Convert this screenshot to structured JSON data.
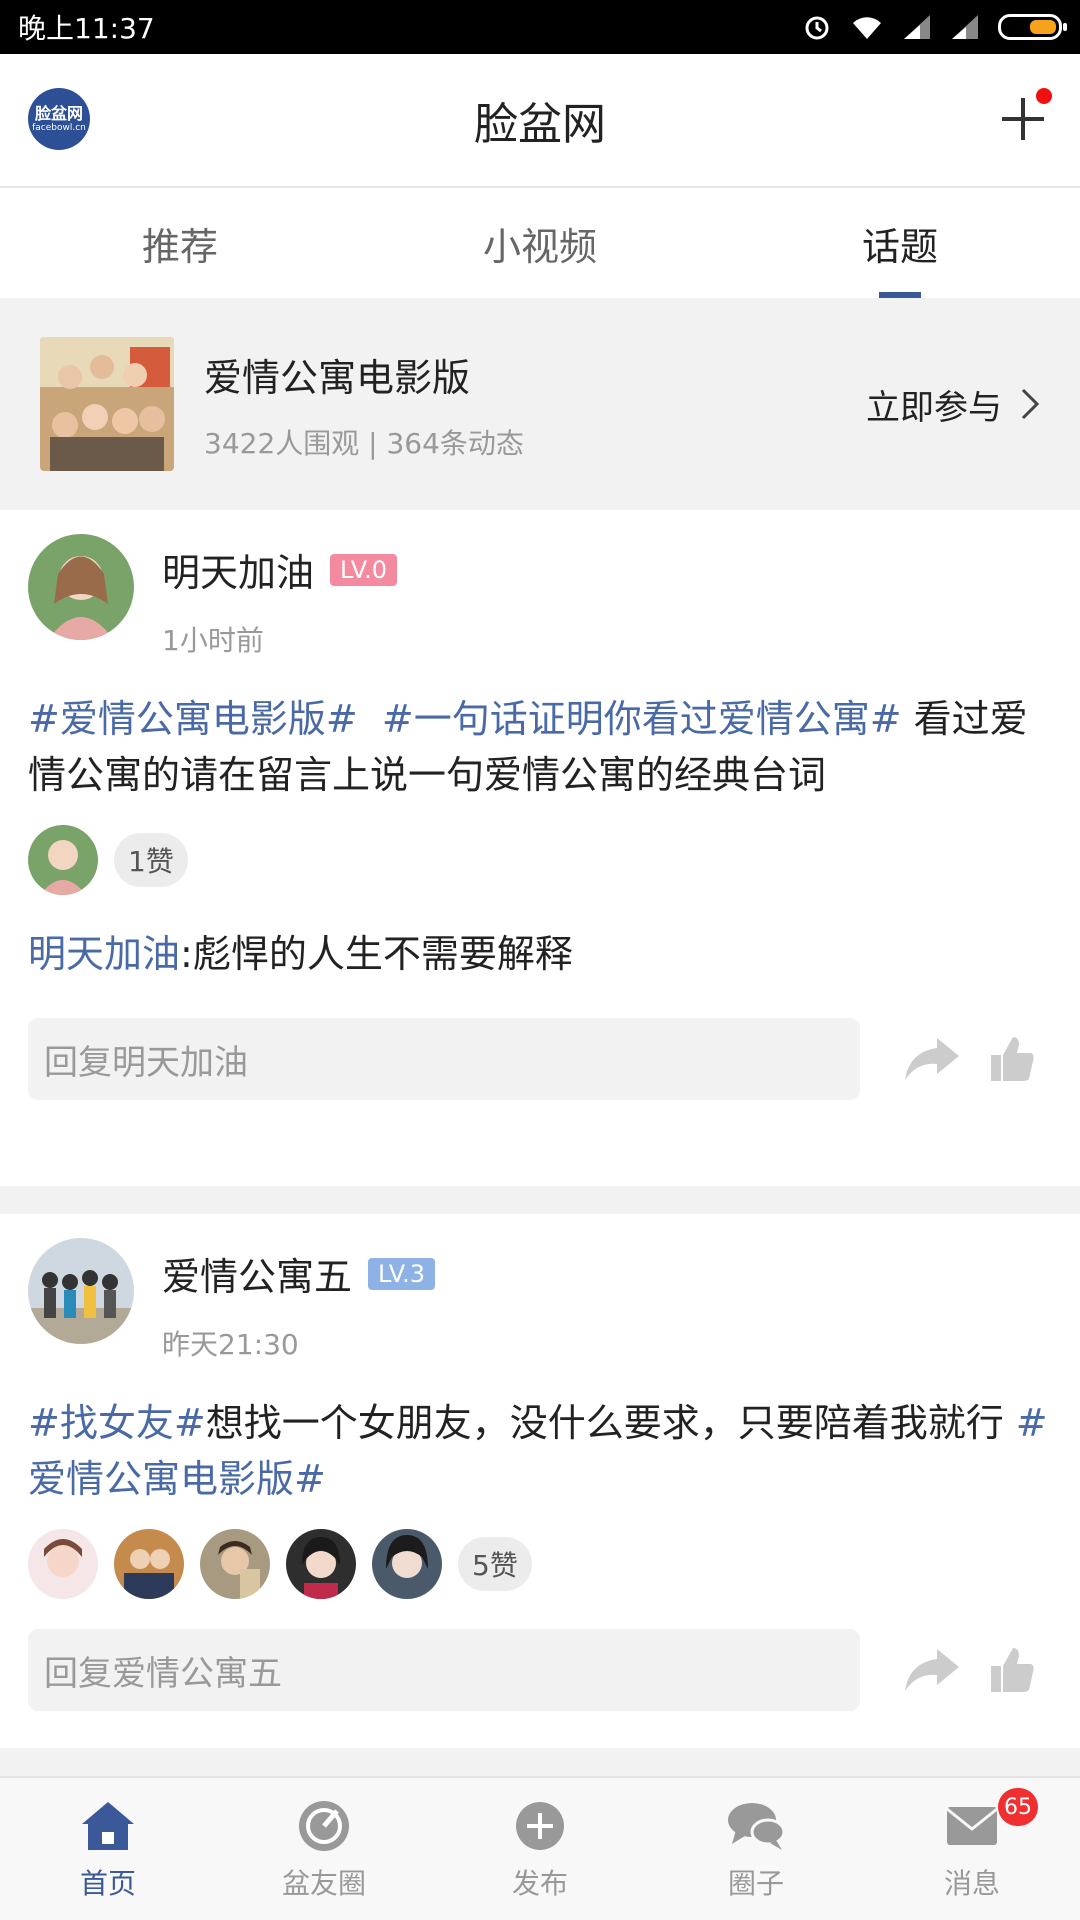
{
  "status_bar": {
    "time": "晚上11:37"
  },
  "app_bar": {
    "logo_line1": "脸盆网",
    "logo_line2": "facebowl.cn",
    "title": "脸盆网"
  },
  "tabs": [
    {
      "label": "推荐",
      "active": false
    },
    {
      "label": "小视频",
      "active": false
    },
    {
      "label": "话题",
      "active": true
    }
  ],
  "topic": {
    "name": "爱情公寓电影版",
    "meta": "3422人围观 | 364条动态",
    "join_label": "立即参与"
  },
  "posts": [
    {
      "username": "明天加油",
      "level": "LV.0",
      "level_color": "#f48aa0",
      "time": "1小时前",
      "tag1": "#爱情公寓电影版#",
      "tag2": "#一句话证明你看过爱情公寓#",
      "text": "看过爱情公寓的请在留言上说一句爱情公寓的经典台词",
      "like_count": "1赞",
      "comment_user": "明天加油",
      "comment_text": ":彪悍的人生不需要解释",
      "reply_placeholder": "回复明天加油"
    },
    {
      "username": "爱情公寓五",
      "level": "LV.3",
      "level_color": "#8fb2e6",
      "time": "昨天21:30",
      "tag1": "#找女友#",
      "text": "想找一个女朋友，没什么要求，只要陪着我就行 ",
      "tag2": "#爱情公寓电影版#",
      "like_count": "5赞",
      "reply_placeholder": "回复爱情公寓五"
    }
  ],
  "bottom_nav": [
    {
      "label": "首页",
      "icon": "home-icon",
      "active": true
    },
    {
      "label": "盆友圈",
      "icon": "compass-icon",
      "active": false
    },
    {
      "label": "发布",
      "icon": "add-circle-icon",
      "active": false
    },
    {
      "label": "圈子",
      "icon": "chat-bubbles-icon",
      "active": false
    },
    {
      "label": "消息",
      "icon": "mail-icon",
      "active": false,
      "badge": "65"
    }
  ],
  "colors": {
    "accent": "#3b5998",
    "tag": "#4a6aa6"
  }
}
